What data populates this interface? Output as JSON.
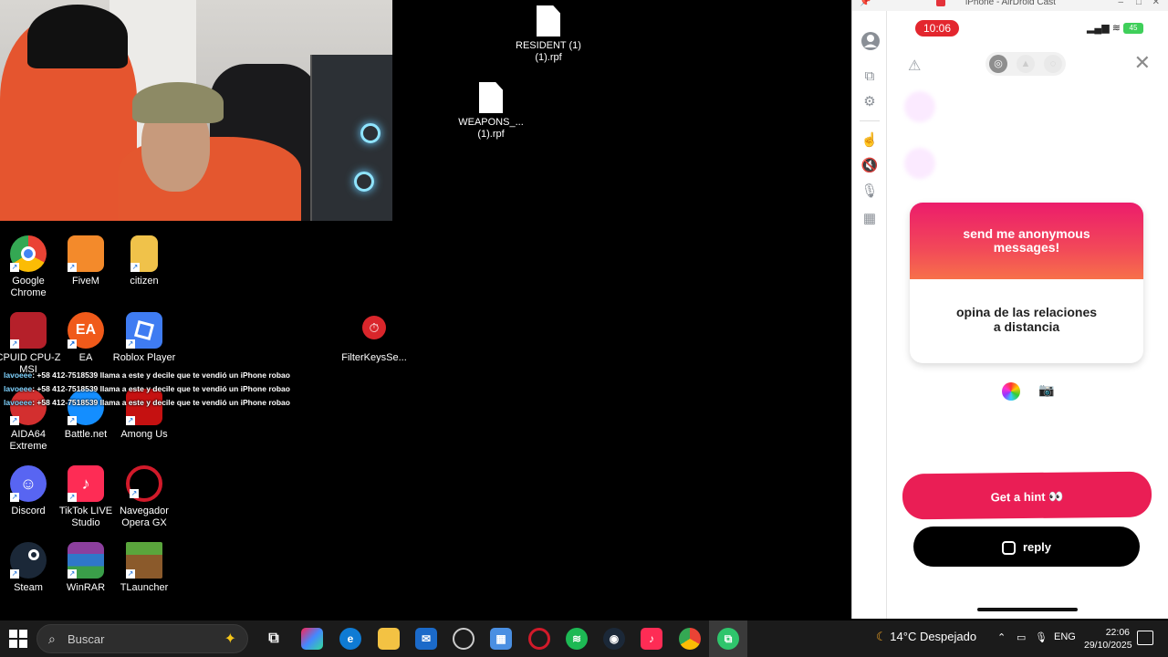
{
  "desktop": {
    "files": [
      {
        "name": "RESIDENT (1)\n(1).rpf",
        "l1": "RESIDENT (1)",
        "l2": "(1).rpf"
      },
      {
        "name": "WEAPONS_...\n(1).rpf",
        "l1": "WEAPONS_...",
        "l2": "(1).rpf"
      }
    ],
    "icons": [
      {
        "label": "Google Chrome",
        "l1": "Google",
        "l2": "Chrome"
      },
      {
        "label": "FiveM"
      },
      {
        "label": "citizen"
      },
      {
        "label": "CPUID CPU-Z MSI",
        "l1": "CPUID CPU-Z",
        "l2": "MSI"
      },
      {
        "label": "EA"
      },
      {
        "label": "Roblox Player"
      },
      {
        "label": "AIDA64 Extreme",
        "l1": "AIDA64",
        "l2": "Extreme"
      },
      {
        "label": "Battle.net"
      },
      {
        "label": "Among Us"
      },
      {
        "label": "Discord"
      },
      {
        "label": "TikTok LIVE Studio",
        "l1": "TikTok LIVE",
        "l2": "Studio"
      },
      {
        "label": "Navegador Opera GX",
        "l1": "Navegador",
        "l2": "Opera GX"
      },
      {
        "label": "Steam"
      },
      {
        "label": "WinRAR"
      },
      {
        "label": "TLauncher"
      },
      {
        "label": "FilterKeysSe..."
      }
    ]
  },
  "chat": {
    "user": "lavoeee",
    "message": ": +58 412-7518539 llama a este y decile que te vendió un iPhone robao"
  },
  "airdroid": {
    "window_title": "iPhone - AirDroid Cast",
    "phone": {
      "time": "10:06",
      "battery": "45",
      "card_header": "send me anonymous messages!",
      "card_header_l1": "send me anonymous",
      "card_header_l2": "messages!",
      "card_body_l1": "opina de las relaciones",
      "card_body_l2": "a distancia",
      "hint_button": "Get a hint 👀",
      "reply_button": "reply"
    }
  },
  "taskbar": {
    "search_placeholder": "Buscar",
    "weather": "14°C Despejado",
    "language": "ENG",
    "time": "22:06",
    "date": "29/10/2025"
  },
  "colors": {
    "accent_pink": "#ea1e55",
    "status_red": "#e3262e"
  }
}
